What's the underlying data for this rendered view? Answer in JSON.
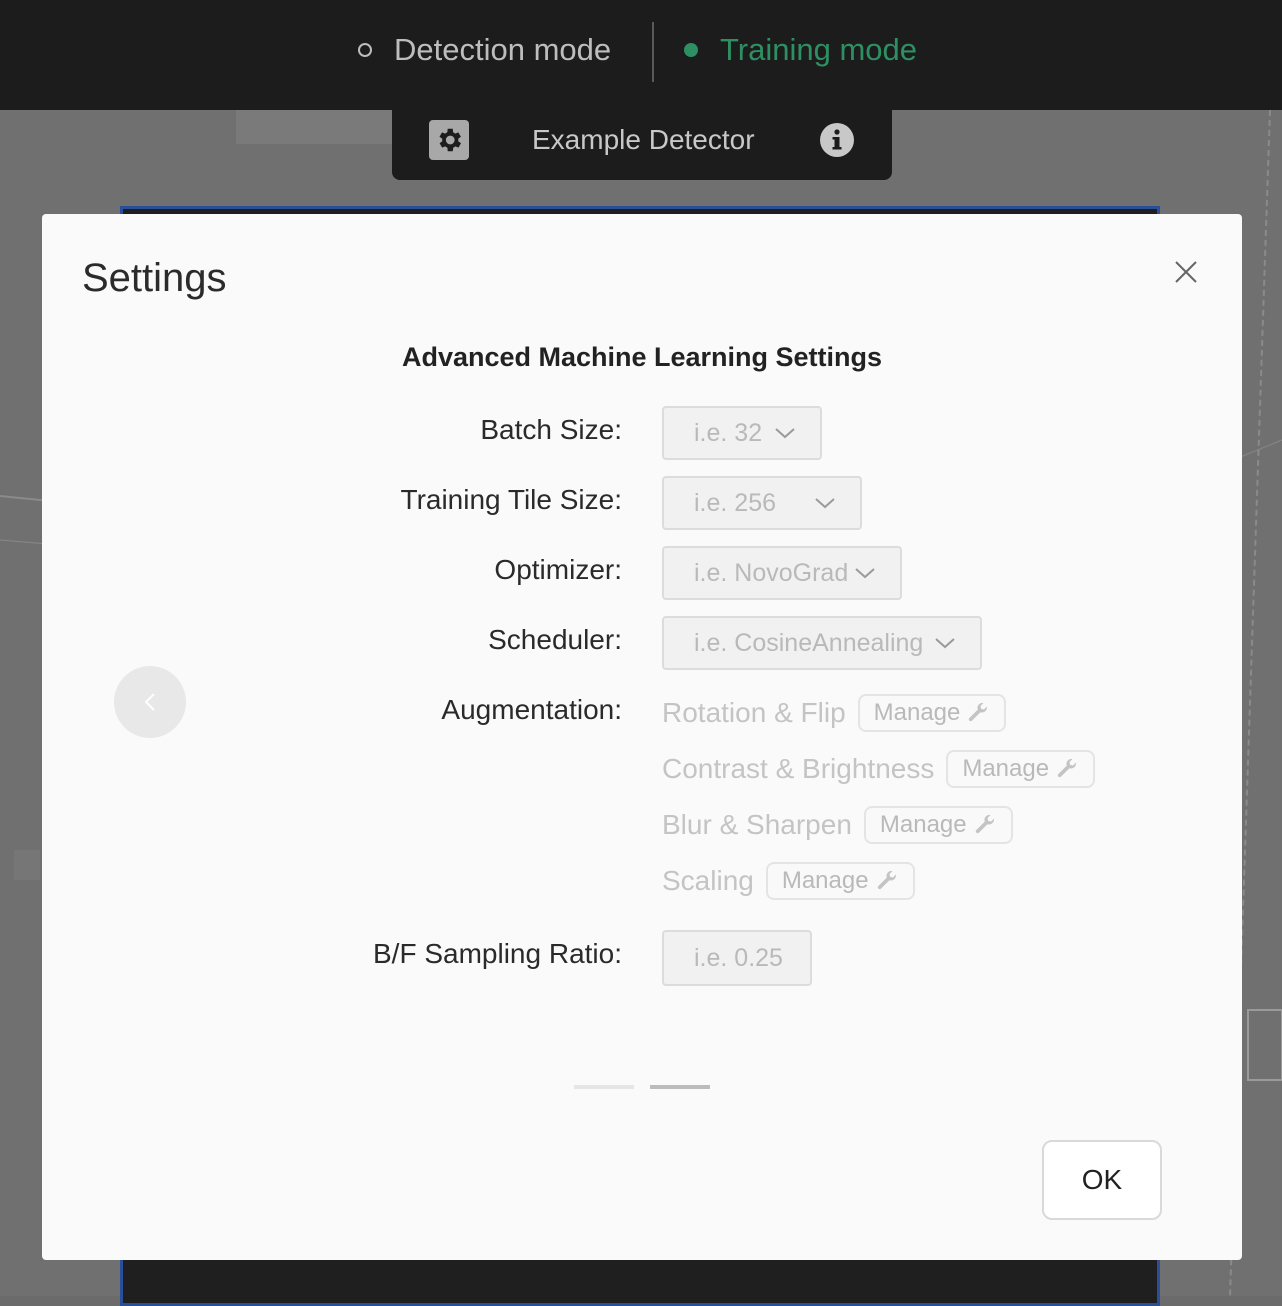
{
  "topbar": {
    "detection_mode_label": "Detection mode",
    "training_mode_label": "Training mode",
    "active_mode": "Training mode"
  },
  "detector": {
    "name": "Example Detector"
  },
  "modal": {
    "title": "Settings",
    "section_title": "Advanced Machine Learning Settings",
    "fields": {
      "batch_size": {
        "label": "Batch Size:",
        "placeholder": "i.e. 32"
      },
      "tile_size": {
        "label": "Training Tile Size:",
        "placeholder": "i.e. 256"
      },
      "optimizer": {
        "label": "Optimizer:",
        "placeholder": "i.e. NovoGrad"
      },
      "scheduler": {
        "label": "Scheduler:",
        "placeholder": "i.e. CosineAnnealing"
      },
      "augmentation": {
        "label": "Augmentation:",
        "items": [
          {
            "name": "Rotation & Flip",
            "button": "Manage"
          },
          {
            "name": "Contrast & Brightness",
            "button": "Manage"
          },
          {
            "name": "Blur & Sharpen",
            "button": "Manage"
          },
          {
            "name": "Scaling",
            "button": "Manage"
          }
        ]
      },
      "sampling_ratio": {
        "label": "B/F Sampling Ratio:",
        "placeholder": "i.e. 0.25"
      }
    },
    "carousel": {
      "current_page": 2,
      "total_pages": 2
    },
    "ok_label": "OK"
  },
  "colors": {
    "active_mode": "#2e8f63",
    "topbar_bg": "#1c1c1c",
    "modal_bg": "#fafafa"
  },
  "icons": [
    "gear-icon",
    "info-icon",
    "close-icon",
    "chevron-down-icon",
    "wrench-icon",
    "chevron-left-icon"
  ]
}
